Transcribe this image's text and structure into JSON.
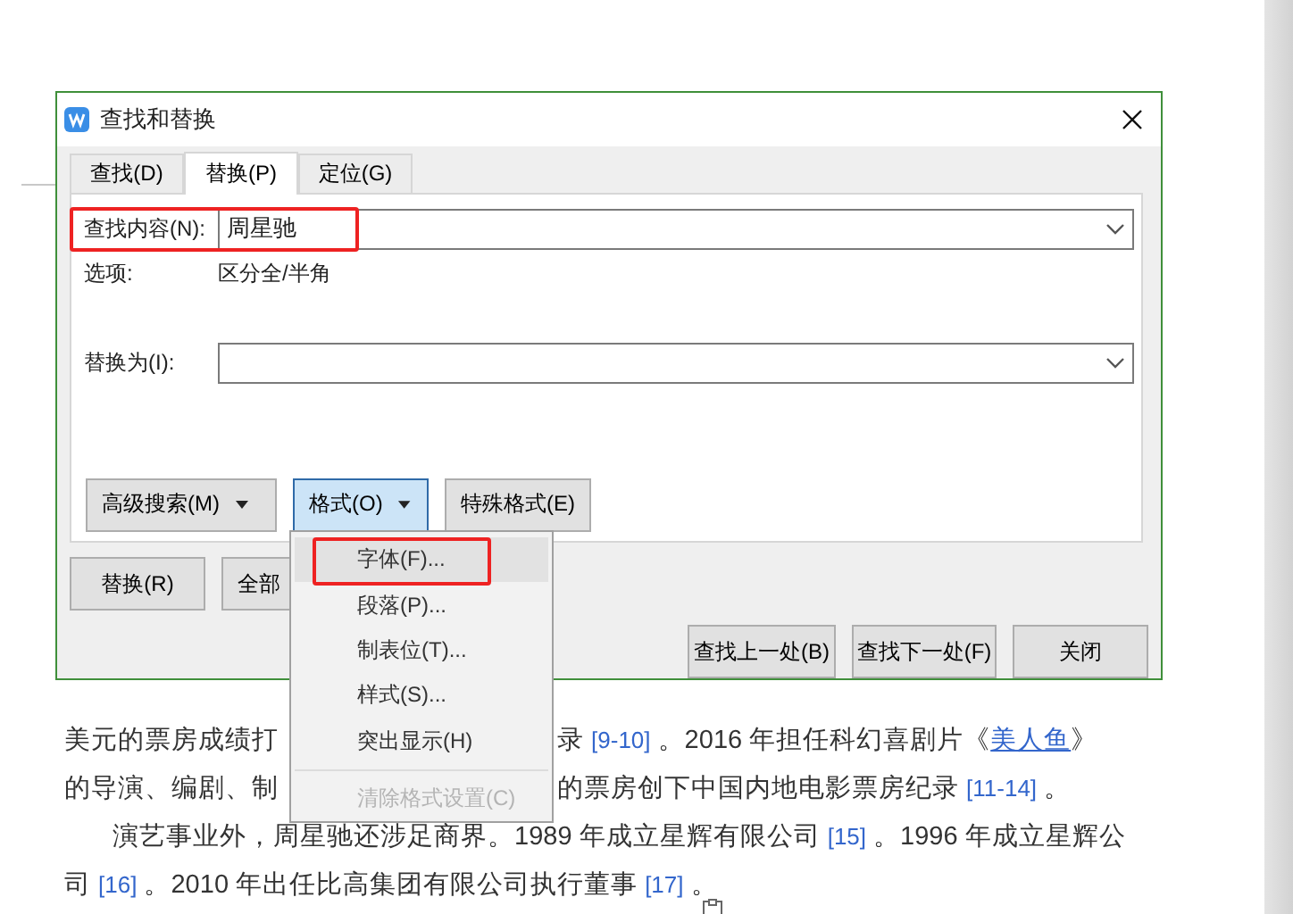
{
  "document": {
    "lines": [
      {
        "indent": false,
        "pieces": [
          [
            {
              "kind": "text",
              "text": "美元的票房成绩打"
            }
          ],
          [
            {
              "kind": "text",
              "text": "录 "
            },
            {
              "kind": "ref",
              "text": "[9-10]"
            },
            {
              "kind": "text",
              "text": " 。2016 年担任科幻喜剧片《"
            },
            {
              "kind": "link",
              "text": "美人鱼"
            },
            {
              "kind": "text",
              "text": "》"
            }
          ]
        ]
      },
      {
        "indent": false,
        "pieces": [
          [
            {
              "kind": "text",
              "text": "的导演、编剧、制"
            }
          ],
          [
            {
              "kind": "text",
              "text": "的票房创下中国内地电影票房纪录 "
            },
            {
              "kind": "ref",
              "text": "[11-14]"
            },
            {
              "kind": "text",
              "text": " 。"
            }
          ]
        ]
      },
      {
        "indent": true,
        "pieces": [
          [
            {
              "kind": "text",
              "text": "演艺事业外，周星驰还涉足商界。1989 年成立星辉有限公司 "
            },
            {
              "kind": "ref",
              "text": "[15]"
            },
            {
              "kind": "text",
              "text": " 。1996 年成立星辉公"
            }
          ]
        ]
      },
      {
        "indent": false,
        "pieces": [
          [
            {
              "kind": "text",
              "text": "司 "
            },
            {
              "kind": "ref",
              "text": "[16]"
            },
            {
              "kind": "text",
              "text": " 。2010 年出任比高集团有限公司执行董事 "
            },
            {
              "kind": "ref",
              "text": "[17]"
            },
            {
              "kind": "text",
              "text": " 。"
            }
          ]
        ]
      }
    ]
  },
  "dialog": {
    "title": "查找和替换",
    "tabs": [
      {
        "label": "查找(D)",
        "selected": false
      },
      {
        "label": "替换(P)",
        "selected": true
      },
      {
        "label": "定位(G)",
        "selected": false
      }
    ],
    "find": {
      "label": "查找内容(N):",
      "value": "周星驰",
      "highlighted": true
    },
    "options": {
      "label": "选项:",
      "value": "区分全/半角"
    },
    "replace": {
      "label": "替换为(I):"
    },
    "format_buttons": [
      {
        "label": "高级搜索(M)",
        "selected": false
      },
      {
        "label": "格式(O)",
        "selected": true
      },
      {
        "label": "特殊格式(E)",
        "selected": false
      }
    ],
    "action_buttons": [
      "替换(R)",
      "全部"
    ],
    "nav_buttons": [
      "查找上一处(B)",
      "查找下一处(F)",
      "关闭"
    ]
  },
  "menu": {
    "items": [
      {
        "kind": "item",
        "label": "字体(F)...",
        "selected": true,
        "disabled": false,
        "highlighted": true
      },
      {
        "kind": "item",
        "label": "段落(P)...",
        "selected": false,
        "disabled": false,
        "highlighted": false
      },
      {
        "kind": "item",
        "label": "制表位(T)...",
        "selected": false,
        "disabled": false,
        "highlighted": false
      },
      {
        "kind": "item",
        "label": "样式(S)...",
        "selected": false,
        "disabled": false,
        "highlighted": false
      },
      {
        "kind": "item",
        "label": "突出显示(H)",
        "selected": false,
        "disabled": false,
        "highlighted": false
      },
      {
        "kind": "separator"
      },
      {
        "kind": "item",
        "label": "清除格式设置(C)",
        "selected": false,
        "disabled": true,
        "highlighted": false
      }
    ]
  }
}
